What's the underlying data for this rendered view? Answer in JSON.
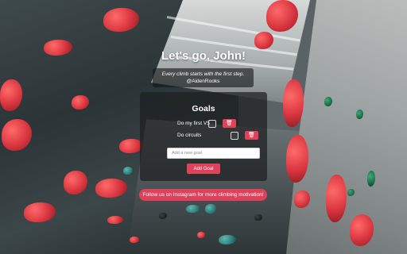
{
  "header": {
    "greeting": "Let's go, John!"
  },
  "quote": {
    "text": "Every climb starts with the first step.",
    "author": "@AidenRooks"
  },
  "goals": {
    "title": "Goals",
    "items": [
      {
        "label": "Do my first V5",
        "checked": false,
        "delete_icon": "trash-icon"
      },
      {
        "label": "Do circuits",
        "checked": false,
        "delete_icon": "trash-icon"
      }
    ],
    "input_placeholder": "Add a new goal",
    "input_value": "",
    "add_button_label": "Add Goal"
  },
  "social": {
    "instagram_label": "Follow us on Instagram for more climbing motivation!"
  },
  "colors": {
    "accent": "#e0415a",
    "card_bg": "rgba(28,30,32,0.72)"
  },
  "background": {
    "image": "climbing-gym-wall"
  }
}
